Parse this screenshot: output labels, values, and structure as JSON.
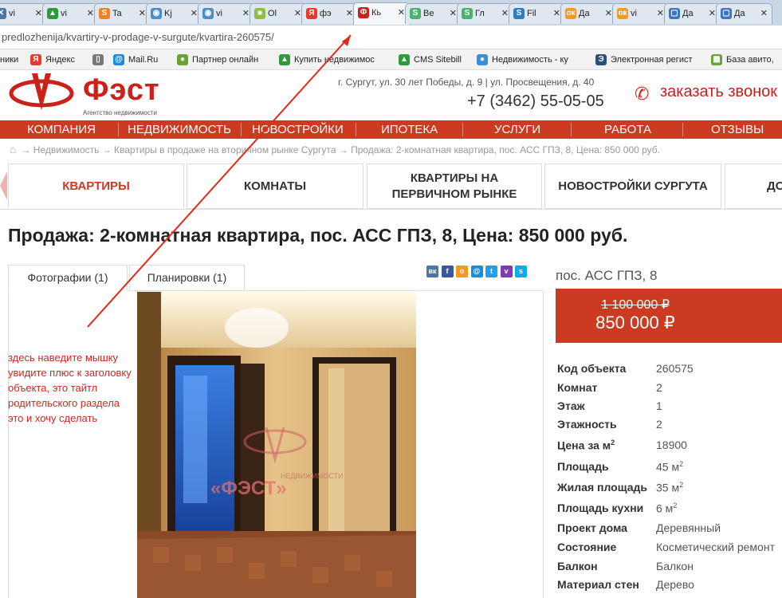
{
  "browser": {
    "tabs": [
      {
        "label": "vi",
        "icon": "vk-icon",
        "color": "#4a76a8",
        "glyph": "✕"
      },
      {
        "label": "vi",
        "icon": "house-icon",
        "color": "#2e9a3c",
        "glyph": "▲"
      },
      {
        "label": "Ta",
        "icon": "stackoverflow-icon",
        "color": "#f48024",
        "glyph": "S"
      },
      {
        "label": "Kj",
        "icon": "globe-icon",
        "color": "#4a8ccf",
        "glyph": "◉"
      },
      {
        "label": "vi",
        "icon": "globe-icon",
        "color": "#4a8ccf",
        "glyph": "◉"
      },
      {
        "label": "Ol",
        "icon": "puzzle-icon",
        "color": "#8fbf3f",
        "glyph": "■"
      },
      {
        "label": "фэ",
        "icon": "yandex-icon",
        "color": "#e8392b",
        "glyph": "Я"
      },
      {
        "label": "Кь",
        "icon": "fest-logo-icon",
        "color": "#c8221b",
        "glyph": "Ф"
      },
      {
        "label": "Ве",
        "icon": "s-icon",
        "color": "#49b36b",
        "glyph": "S"
      },
      {
        "label": "Гл",
        "icon": "s-icon",
        "color": "#49b36b",
        "glyph": "S"
      },
      {
        "label": "Fil",
        "icon": "s-icon",
        "color": "#2e7dbf",
        "glyph": "S"
      },
      {
        "label": "Да",
        "icon": "ok-icon",
        "color": "#f59a1f",
        "glyph": "ок"
      },
      {
        "label": "vi",
        "icon": "ok-icon",
        "color": "#f59a1f",
        "glyph": "ок"
      },
      {
        "label": "Да",
        "icon": "chat-icon",
        "color": "#3a78c5",
        "glyph": "▢"
      },
      {
        "label": "Да",
        "icon": "chat-icon",
        "color": "#3a78c5",
        "glyph": "▢"
      }
    ],
    "close_glyph": "✕",
    "url": "predlozhenija/kvartiry-v-prodage-v-surgute/kvartira-260575/",
    "bookmarks": [
      {
        "label": "ники",
        "icon": "",
        "color": "",
        "glyph": ""
      },
      {
        "label": "Яндекс",
        "icon": "yandex-icon",
        "color": "#e8392b",
        "glyph": "Я"
      },
      {
        "label": "",
        "icon": "page-icon",
        "color": "#777",
        "glyph": "▯"
      },
      {
        "label": "Mail.Ru",
        "icon": "mailru-icon",
        "color": "#168de2",
        "glyph": "@"
      },
      {
        "label": "Партнер онлайн",
        "icon": "leaf-icon",
        "color": "#6aa335",
        "glyph": "●"
      },
      {
        "label": "Купить недвижимос",
        "icon": "house-icon",
        "color": "#2e9a3c",
        "glyph": "▲"
      },
      {
        "label": "CMS Sitebill",
        "icon": "house-icon",
        "color": "#2e9a3c",
        "glyph": "▲"
      },
      {
        "label": "Недвижимость - ку",
        "icon": "people-icon",
        "color": "#3a8fd6",
        "glyph": "●"
      },
      {
        "label": "Электронная регист",
        "icon": "e-icon",
        "color": "#2b4f7e",
        "glyph": "Э"
      },
      {
        "label": "База авито,",
        "icon": "blocks-icon",
        "color": "#6aa335",
        "glyph": "▦"
      }
    ]
  },
  "site": {
    "logo": "Фэст",
    "logo_sub": "Агентство недвижимости",
    "address": "г. Сургут, ул. 30 лет Победы, д. 9 | ул. Просвещения, д. 40",
    "phone": "+7 (3462) 55-05-05",
    "callback": "заказать звонок",
    "nav": [
      "Компания",
      "Недвижимость",
      "Новостройки",
      "Ипотека",
      "Услуги",
      "Работа",
      "Отзывы"
    ],
    "breadcrumbs": "→ Недвижимость → Квартиры в продаже на вторичном рынке Сургута → Продажа: 2-комнатная квартира, пос. АСС ГПЗ, 8, Цена: 850 000 руб.",
    "category_tabs": [
      "Квартиры",
      "Комнаты",
      "Квартиры на первичном рынке",
      "Новостройки Сургута",
      "До"
    ]
  },
  "listing": {
    "title": "Продажа: 2-комнатная квартира, пос. АСС ГПЗ, 8, Цена: 850 000 руб.",
    "photo_tabs": [
      "Фотографии (1)",
      "Планировки (1)"
    ],
    "share_icons": [
      {
        "name": "vk-share-icon",
        "color": "#4a76a8",
        "glyph": "вк"
      },
      {
        "name": "facebook-share-icon",
        "color": "#3b5998",
        "glyph": "f"
      },
      {
        "name": "odnoklassniki-share-icon",
        "color": "#f59a1f",
        "glyph": "о"
      },
      {
        "name": "moimir-share-icon",
        "color": "#168de2",
        "glyph": "@"
      },
      {
        "name": "twitter-share-icon",
        "color": "#1da1f2",
        "glyph": "t"
      },
      {
        "name": "viber-share-icon",
        "color": "#7d3daf",
        "glyph": "v"
      },
      {
        "name": "skype-share-icon",
        "color": "#00aff0",
        "glyph": "s"
      }
    ],
    "address": "пос. АСС ГПЗ, 8",
    "old_price": "1 100 000 ₽",
    "price": "850 000 ₽",
    "watermark_top": "НЕДВИЖИМОСТИ",
    "watermark": "«ФЭСТ»",
    "properties": [
      {
        "label": "Код объекта",
        "value": "260575",
        "unit": ""
      },
      {
        "label": "Комнат",
        "value": "2",
        "unit": ""
      },
      {
        "label": "Этаж",
        "value": "1",
        "unit": ""
      },
      {
        "label": "Этажность",
        "value": "2",
        "unit": ""
      },
      {
        "label": "Цена за м",
        "value": "18900",
        "unit": ""
      },
      {
        "label": "Площадь",
        "value": "45 м",
        "unit": "2"
      },
      {
        "label": "Жилая площадь",
        "value": "35 м",
        "unit": "2"
      },
      {
        "label": "Площадь кухни",
        "value": "6 м",
        "unit": "2"
      },
      {
        "label": "Проект дома",
        "value": "Деревянный",
        "unit": ""
      },
      {
        "label": "Состояние",
        "value": "Косметический ремонт",
        "unit": ""
      },
      {
        "label": "Балкон",
        "value": "Балкон",
        "unit": ""
      },
      {
        "label": "Материал стен",
        "value": "Дерево",
        "unit": ""
      }
    ],
    "price_per_m_sup": "2"
  },
  "annotation": {
    "text": "здесь наведите мышку увидите плюс к заголовку объекта, это тайтл родительского раздела это и хочу сделать"
  },
  "colors": {
    "brand_red": "#cc3a21",
    "logo_red": "#c8221b",
    "annotation_red": "#cc2b1c"
  }
}
